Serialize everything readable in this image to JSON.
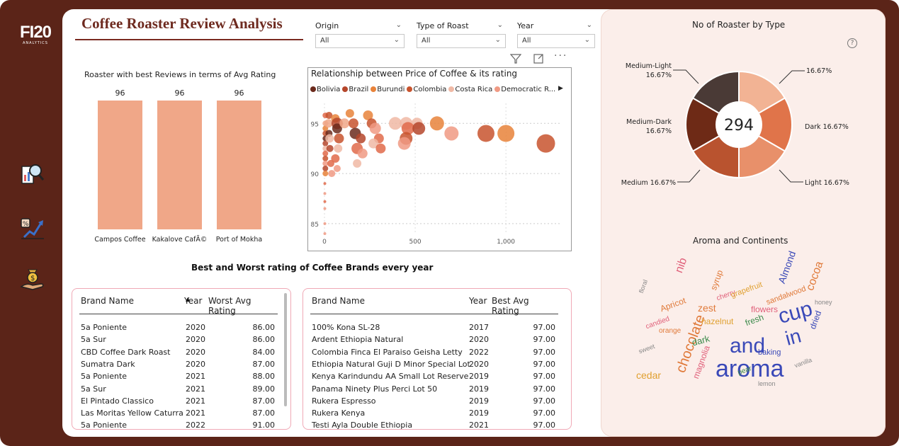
{
  "app": {
    "logo_text": "FI20",
    "logo_sub": "ANALYTICS",
    "title": "Coffee Roaster Review Analysis"
  },
  "nav": [
    {
      "name": "magnifier-chart-icon"
    },
    {
      "name": "growth-chart-icon"
    },
    {
      "name": "hand-money-icon"
    }
  ],
  "filters": [
    {
      "label": "Origin",
      "value": "All"
    },
    {
      "label": "Type of Roast",
      "value": "All"
    },
    {
      "label": "Year",
      "value": "All"
    }
  ],
  "toolbar": {
    "filter": "filter-icon",
    "focus": "focus-mode-icon",
    "more": "more-options-icon"
  },
  "colors": {
    "frame": "#5b2418",
    "bar": "#f0a788",
    "accent_title": "#6e2a1f",
    "table_border": "#f0a9b6",
    "panel": "#fbeeea"
  },
  "bar_chart": {
    "title": "Roaster with best Reviews in terms of Avg Rating",
    "chart_data": {
      "type": "bar",
      "categories": [
        "Campos Coffee",
        "Kakalove CafÃ©",
        "Port of Mokha"
      ],
      "values": [
        96,
        96,
        96
      ],
      "data_labels": [
        "96",
        "96",
        "96"
      ]
    }
  },
  "scatter": {
    "title": "Relationship between Price of Coffee & its rating",
    "legend": [
      {
        "name": "Bolivia",
        "color": "#6b2a1c"
      },
      {
        "name": "Brazil",
        "color": "#b5462b"
      },
      {
        "name": "Burundi",
        "color": "#e8833a"
      },
      {
        "name": "Colombia",
        "color": "#c8542e"
      },
      {
        "name": "Costa Rica",
        "color": "#f0b9a5"
      },
      {
        "name": "Democratic R...",
        "color": "#f09a84"
      }
    ],
    "legend_next": "▶",
    "y_ticks": [
      "95",
      "90",
      "85"
    ],
    "x_ticks": [
      "0",
      "500",
      "1,000"
    ],
    "chart_data": {
      "type": "scatter",
      "x_range": [
        0,
        1300
      ],
      "y_range": [
        84,
        97
      ],
      "points": [
        {
          "x": 5,
          "y": 95.8,
          "r": 4,
          "c": "#e06a4a"
        },
        {
          "x": 5,
          "y": 95.0,
          "r": 4,
          "c": "#f0a788"
        },
        {
          "x": 5,
          "y": 94.5,
          "r": 4,
          "c": "#e8833a"
        },
        {
          "x": 5,
          "y": 94.0,
          "r": 4,
          "c": "#c8542e"
        },
        {
          "x": 5,
          "y": 93.5,
          "r": 4,
          "c": "#6b2a1c"
        },
        {
          "x": 5,
          "y": 93.0,
          "r": 4,
          "c": "#b5462b"
        },
        {
          "x": 5,
          "y": 92.5,
          "r": 4,
          "c": "#f0b9a5"
        },
        {
          "x": 5,
          "y": 92.0,
          "r": 4,
          "c": "#e06a4a"
        },
        {
          "x": 5,
          "y": 91.5,
          "r": 4,
          "c": "#c8542e"
        },
        {
          "x": 5,
          "y": 91.0,
          "r": 4,
          "c": "#f09a84"
        },
        {
          "x": 5,
          "y": 90.5,
          "r": 4,
          "c": "#b5462b"
        },
        {
          "x": 5,
          "y": 90.0,
          "r": 4,
          "c": "#e8833a"
        },
        {
          "x": 2,
          "y": 89.0,
          "r": 2,
          "c": "#e06a4a"
        },
        {
          "x": 2,
          "y": 88.0,
          "r": 2,
          "c": "#f09a84"
        },
        {
          "x": 2,
          "y": 87.2,
          "r": 2,
          "c": "#e06a4a"
        },
        {
          "x": 2,
          "y": 86.5,
          "r": 2,
          "c": "#f09a84"
        },
        {
          "x": 2,
          "y": 85.0,
          "r": 2,
          "c": "#f09a84"
        },
        {
          "x": 2,
          "y": 84.0,
          "r": 2,
          "c": "#f09a84"
        },
        {
          "x": 25,
          "y": 95.8,
          "r": 5,
          "c": "#c8542e"
        },
        {
          "x": 22,
          "y": 95.0,
          "r": 6,
          "c": "#f0a788"
        },
        {
          "x": 25,
          "y": 94.0,
          "r": 5,
          "c": "#6b2a1c"
        },
        {
          "x": 28,
          "y": 93.5,
          "r": 6,
          "c": "#f0b9a5"
        },
        {
          "x": 30,
          "y": 92.5,
          "r": 5,
          "c": "#b5462b"
        },
        {
          "x": 35,
          "y": 91.0,
          "r": 5,
          "c": "#e06a4a"
        },
        {
          "x": 40,
          "y": 90.0,
          "r": 5,
          "c": "#f09a84"
        },
        {
          "x": 60,
          "y": 95.5,
          "r": 6,
          "c": "#e8833a"
        },
        {
          "x": 70,
          "y": 95.0,
          "r": 8,
          "c": "#b5462b"
        },
        {
          "x": 70,
          "y": 94.5,
          "r": 7,
          "c": "#6b2a1c"
        },
        {
          "x": 80,
          "y": 93.5,
          "r": 7,
          "c": "#c8542e"
        },
        {
          "x": 75,
          "y": 92.5,
          "r": 6,
          "c": "#f0b9a5"
        },
        {
          "x": 60,
          "y": 91.5,
          "r": 6,
          "c": "#e06a4a"
        },
        {
          "x": 70,
          "y": 90.5,
          "r": 5,
          "c": "#f09a84"
        },
        {
          "x": 110,
          "y": 95.0,
          "r": 7,
          "c": "#f0a788"
        },
        {
          "x": 140,
          "y": 96.0,
          "r": 6,
          "c": "#e8833a"
        },
        {
          "x": 160,
          "y": 95.0,
          "r": 7,
          "c": "#c8542e"
        },
        {
          "x": 170,
          "y": 94.0,
          "r": 8,
          "c": "#6b2a1c"
        },
        {
          "x": 200,
          "y": 93.5,
          "r": 7,
          "c": "#b5462b"
        },
        {
          "x": 180,
          "y": 92.5,
          "r": 8,
          "c": "#e06a4a"
        },
        {
          "x": 210,
          "y": 92.0,
          "r": 7,
          "c": "#f09a84"
        },
        {
          "x": 180,
          "y": 91.0,
          "r": 6,
          "c": "#f0b9a5"
        },
        {
          "x": 240,
          "y": 95.8,
          "r": 7,
          "c": "#e8833a"
        },
        {
          "x": 260,
          "y": 95.0,
          "r": 7,
          "c": "#c8542e"
        },
        {
          "x": 280,
          "y": 94.5,
          "r": 8,
          "c": "#f09a84"
        },
        {
          "x": 300,
          "y": 93.5,
          "r": 7,
          "c": "#e06a4a"
        },
        {
          "x": 270,
          "y": 93.0,
          "r": 7,
          "c": "#f0b9a5"
        },
        {
          "x": 310,
          "y": 92.5,
          "r": 7,
          "c": "#e06a4a"
        },
        {
          "x": 390,
          "y": 95.0,
          "r": 9,
          "c": "#f0b9a5"
        },
        {
          "x": 450,
          "y": 95.0,
          "r": 9,
          "c": "#f0b9a5"
        },
        {
          "x": 510,
          "y": 95.0,
          "r": 8,
          "c": "#f0b9a5"
        },
        {
          "x": 460,
          "y": 94.5,
          "r": 9,
          "c": "#e06a4a"
        },
        {
          "x": 520,
          "y": 94.5,
          "r": 9,
          "c": "#b5462b"
        },
        {
          "x": 450,
          "y": 93.5,
          "r": 9,
          "c": "#c8542e"
        },
        {
          "x": 440,
          "y": 93.0,
          "r": 9,
          "c": "#f09a84"
        },
        {
          "x": 620,
          "y": 95.0,
          "r": 10,
          "c": "#e8833a"
        },
        {
          "x": 700,
          "y": 94.0,
          "r": 10,
          "c": "#f09a84"
        },
        {
          "x": 890,
          "y": 94.0,
          "r": 12,
          "c": "#c8542e"
        },
        {
          "x": 1000,
          "y": 94.0,
          "r": 12,
          "c": "#e8833a"
        },
        {
          "x": 1220,
          "y": 93.0,
          "r": 13,
          "c": "#c8542e"
        }
      ]
    }
  },
  "tables": {
    "section_title": "Best and Worst rating of Coffee Brands every year",
    "worst": {
      "headers": [
        "Brand Name",
        "Year",
        "Worst Avg Rating"
      ],
      "rows": [
        [
          "5a Poniente",
          "2020",
          "86.00"
        ],
        [
          "5a Sur",
          "2020",
          "86.00"
        ],
        [
          "CBD Coffee Dark Roast",
          "2020",
          "84.00"
        ],
        [
          "Sumatra Dark",
          "2020",
          "87.00"
        ],
        [
          "5a Poniente",
          "2021",
          "88.00"
        ],
        [
          "5a Sur",
          "2021",
          "89.00"
        ],
        [
          "El Pintado Classico",
          "2021",
          "87.00"
        ],
        [
          "Las Moritas Yellow Caturra",
          "2021",
          "87.00"
        ],
        [
          "5a Poniente",
          "2022",
          "91.00"
        ]
      ]
    },
    "best": {
      "headers": [
        "Brand Name",
        "Year",
        "Best Avg Rating"
      ],
      "rows": [
        [
          "100% Kona SL-28",
          "2017",
          "97.00"
        ],
        [
          "Ardent Ethiopia Natural",
          "2020",
          "97.00"
        ],
        [
          "Colombia Finca El Paraiso Geisha Letty",
          "2022",
          "97.00"
        ],
        [
          "Ethiopia Natural Guji D Minor Special Lot",
          "2020",
          "97.00"
        ],
        [
          "Kenya Karindundu AA Small Lot Reserve",
          "2019",
          "97.00"
        ],
        [
          "Panama Ninety Plus Perci Lot 50",
          "2019",
          "97.00"
        ],
        [
          "Rukera Espresso",
          "2019",
          "97.00"
        ],
        [
          "Rukera Kenya",
          "2019",
          "97.00"
        ],
        [
          "Testi Ayla Double Ethiopia",
          "2021",
          "97.00"
        ]
      ]
    }
  },
  "donut": {
    "title": "No of Roaster by Type",
    "center_value": "294",
    "help_icon": "?",
    "chart_data": {
      "type": "pie",
      "slices": [
        {
          "label": "Light",
          "value": 16.67,
          "color": "#e8906a"
        },
        {
          "label": "Medium",
          "value": 16.67,
          "color": "#b9532f"
        },
        {
          "label": "Medium-Dark",
          "value": 16.67,
          "color": "#6e2a16"
        },
        {
          "label": "Medium-Light",
          "value": 16.67,
          "color": "#4a3a36"
        },
        {
          "label": "",
          "value": 16.67,
          "color": "#f2b394"
        },
        {
          "label": "Dark",
          "value": 16.67,
          "color": "#e0744a"
        }
      ]
    },
    "labels": {
      "medium_light": "Medium-Light",
      "medium_light_pct": "16.67%",
      "top_right_pct": "16.67%",
      "medium_dark": "Medium-Dark",
      "medium_dark_pct": "16.67%",
      "dark": "Dark 16.67%",
      "medium": "Medium 16.67%",
      "light": "Light 16.67%"
    }
  },
  "wordcloud": {
    "title": "Aroma and Continents",
    "words": [
      {
        "t": "aroma",
        "c": "#3a49b8"
      },
      {
        "t": "and",
        "c": "#3a49b8"
      },
      {
        "t": "cup",
        "c": "#3a49b8"
      },
      {
        "t": "in",
        "c": "#3a49b8"
      },
      {
        "t": "chocolate",
        "c": "#e07a3a"
      },
      {
        "t": "Almond",
        "c": "#3a49b8"
      },
      {
        "t": "cocoa",
        "c": "#e07a3a"
      },
      {
        "t": "nib",
        "c": "#e0607a"
      },
      {
        "t": "cedar",
        "c": "#e0a030"
      },
      {
        "t": "zest",
        "c": "#e07a3a"
      },
      {
        "t": "dark",
        "c": "#3a8a4a"
      },
      {
        "t": "fresh",
        "c": "#3a8a4a"
      },
      {
        "t": "flowers",
        "c": "#e0607a"
      },
      {
        "t": "sandalwood",
        "c": "#e07a3a"
      },
      {
        "t": "Apricot",
        "c": "#e07a3a"
      },
      {
        "t": "syrup",
        "c": "#e07a3a"
      },
      {
        "t": "hazelnut",
        "c": "#e0a030"
      },
      {
        "t": "magnolia",
        "c": "#e0607a"
      },
      {
        "t": "baking",
        "c": "#3a49b8"
      },
      {
        "t": "cherry",
        "c": "#e0607a"
      },
      {
        "t": "grapefruit",
        "c": "#e0a030"
      },
      {
        "t": "candied",
        "c": "#e0607a"
      },
      {
        "t": "dried",
        "c": "#3a49b8"
      },
      {
        "t": "orange",
        "c": "#e07a3a"
      },
      {
        "t": "pear",
        "c": "#3a8a4a"
      },
      {
        "t": "sweet",
        "c": "#888888"
      },
      {
        "t": "vanilla",
        "c": "#888888"
      },
      {
        "t": "floral",
        "c": "#888888"
      },
      {
        "t": "honey",
        "c": "#888888"
      },
      {
        "t": "lemon",
        "c": "#888888"
      }
    ]
  }
}
